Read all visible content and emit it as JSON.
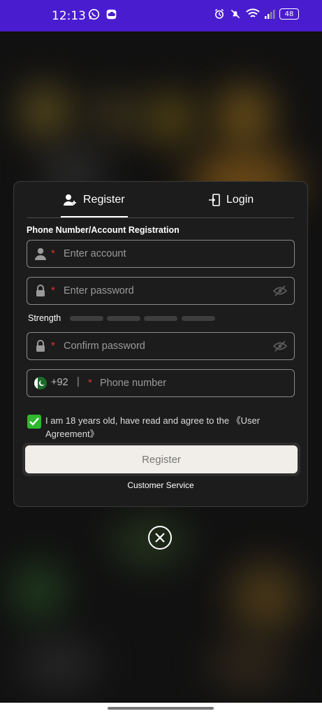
{
  "status_bar": {
    "time": "12:13",
    "battery": "48"
  },
  "tabs": {
    "register": "Register",
    "login": "Login"
  },
  "form": {
    "section_title": "Phone Number/Account Registration",
    "account_placeholder": "Enter account",
    "password_placeholder": "Enter password",
    "strength_label": "Strength",
    "confirm_placeholder": "Confirm password",
    "phone_code": "+92",
    "phone_separator": "|",
    "phone_placeholder": "Phone number",
    "required_mark": "*"
  },
  "agreement": {
    "text": "I am 18 years old, have read and agree to the 《User Agreement》",
    "checked": true
  },
  "buttons": {
    "register": "Register",
    "customer_service": "Customer Service"
  },
  "colors": {
    "status_bar": "#4a1ccf",
    "required": "#e03030",
    "check": "#2eb82e"
  }
}
